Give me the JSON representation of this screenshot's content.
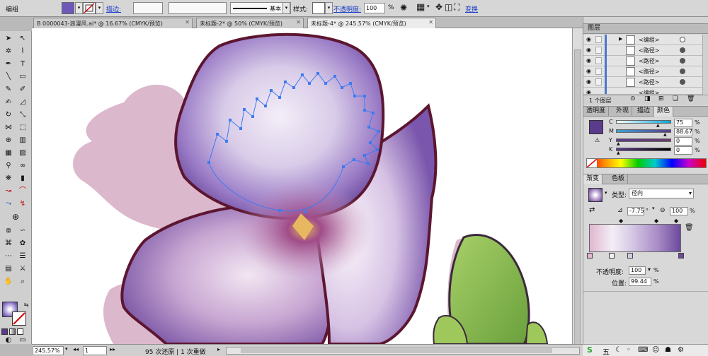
{
  "control_bar": {
    "object_type": "编组",
    "stroke_label": "描边:",
    "stroke_style": "基本",
    "style_label": "样式:",
    "opacity_label": "不透明度:",
    "opacity_value": "100",
    "opacity_unit": "%",
    "transform_label": "变换"
  },
  "document_tabs": [
    {
      "label": "B 0000043-浪漫风.ai* @ 16.67% (CMYK/预览)",
      "active": false
    },
    {
      "label": "未标题-2* @ 50% (CMYK/预览)",
      "active": false
    },
    {
      "label": "未标题-4* @ 245.57% (CMYK/预览)",
      "active": true
    }
  ],
  "layers_panel": {
    "title": "图层",
    "items": [
      "<编组>",
      "<路径>",
      "<路径>",
      "<路径>",
      "<路径>",
      "<编组>"
    ],
    "footer": "1 个图层"
  },
  "color_panel": {
    "tabs": [
      "透明度",
      "外观",
      "描边",
      "颜色"
    ],
    "channels": [
      {
        "name": "C",
        "value": "75",
        "unit": "%",
        "level": 0.75
      },
      {
        "name": "M",
        "value": "88.67",
        "unit": "%",
        "level": 0.8867
      },
      {
        "name": "Y",
        "value": "0",
        "unit": "%",
        "level": 0
      },
      {
        "name": "K",
        "value": "0",
        "unit": "%",
        "level": 0
      }
    ],
    "fill_color": "#5a3b8c"
  },
  "gradient_panel": {
    "tabs": [
      "渐变",
      "色板"
    ],
    "type_label": "类型:",
    "type_value": "径向",
    "angle_value": "-7.75",
    "angle_unit": "°",
    "ratio_value": "100",
    "ratio_unit": "%",
    "opacity_label": "不透明度:",
    "opacity_value": "100",
    "opacity_unit": "%",
    "location_label": "位置:",
    "location_value": "99.44",
    "location_unit": "%",
    "colors": [
      "#e0b6d0",
      "#f4eef6",
      "#d8cbe5",
      "#a98bc6",
      "#6a4a9c"
    ]
  },
  "status_bar": {
    "zoom": "245.57%",
    "page": "1",
    "undo_redo": "95 次还原 | 1 次重做"
  },
  "colors": {
    "petal_dark": "#5a3b8c",
    "petal_light": "#e8e0f2",
    "outline": "#5c1630",
    "shadow": "#dcb8cc",
    "leaf": "#8cbf4f",
    "leaf_edge": "#3a2a3a",
    "selection": "#3d7bf0"
  }
}
